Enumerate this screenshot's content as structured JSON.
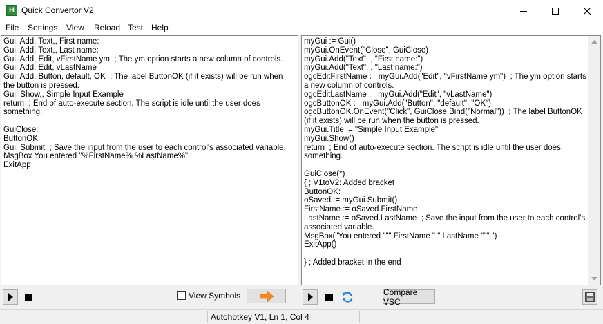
{
  "window": {
    "title": "Quick Convertor V2",
    "app_icon_letter": "H"
  },
  "menu": {
    "items": [
      "File",
      "Settings",
      "View",
      "Reload",
      "Test",
      "Help"
    ]
  },
  "left_editor": {
    "text": "Gui, Add, Text,, First name:\nGui, Add, Text,, Last name:\nGui, Add, Edit, vFirstName ym  ; The ym option starts a new column of controls.\nGui, Add, Edit, vLastName\nGui, Add, Button, default, OK  ; The label ButtonOK (if it exists) will be run when the button is pressed.\nGui, Show,, Simple Input Example\nreturn  ; End of auto-execute section. The script is idle until the user does something.\n\nGuiClose:\nButtonOK:\nGui, Submit  ; Save the input from the user to each control's associated variable.\nMsgBox You entered \"%FirstName% %LastName%\".\nExitApp"
  },
  "right_editor": {
    "text": "myGui := Gui()\nmyGui.OnEvent(\"Close\", GuiClose)\nmyGui.Add(\"Text\", , \"First name:\")\nmyGui.Add(\"Text\", , \"Last name:\")\nogcEditFirstName := myGui.Add(\"Edit\", \"vFirstName ym\")  ; The ym option starts a new column of controls.\nogcEditLastName := myGui.Add(\"Edit\", \"vLastName\")\nogcButtonOK := myGui.Add(\"Button\", \"default\", \"OK\")\nogcButtonOK.OnEvent(\"Click\", GuiClose.Bind(\"Normal\"))  ; The label ButtonOK (if it exists) will be run when the button is pressed.\nmyGui.Title := \"Simple Input Example\"\nmyGui.Show()\nreturn  ; End of auto-execute section. The script is idle until the user does something.\n\nGuiClose(*)\n{ ; V1toV2: Added bracket\nButtonOK:\noSaved := myGui.Submit()\nFirstName := oSaved.FirstName\nLastName := oSaved.LastName  ; Save the input from the user to each control's associated variable.\nMsgBox(\"You entered \"\"\" FirstName \" \" LastName \"\"\".\")\nExitApp()\n\n} ; Added bracket in the end"
  },
  "toolbar": {
    "view_symbols_label": "View Symbols",
    "view_symbols_checked": false,
    "compare_label": "Compare VSC"
  },
  "status": {
    "text": "Autohotkey V1, Ln 1,  Col 4"
  },
  "colors": {
    "convert_arrow": "#f5891f",
    "reload_icon": "#1e7fd8",
    "app_icon": "#2e8b3a"
  },
  "icons": [
    "app-icon",
    "minimize-icon",
    "maximize-icon",
    "close-icon",
    "play-icon",
    "stop-icon",
    "arrow-right-icon",
    "refresh-icon",
    "save-icon"
  ]
}
